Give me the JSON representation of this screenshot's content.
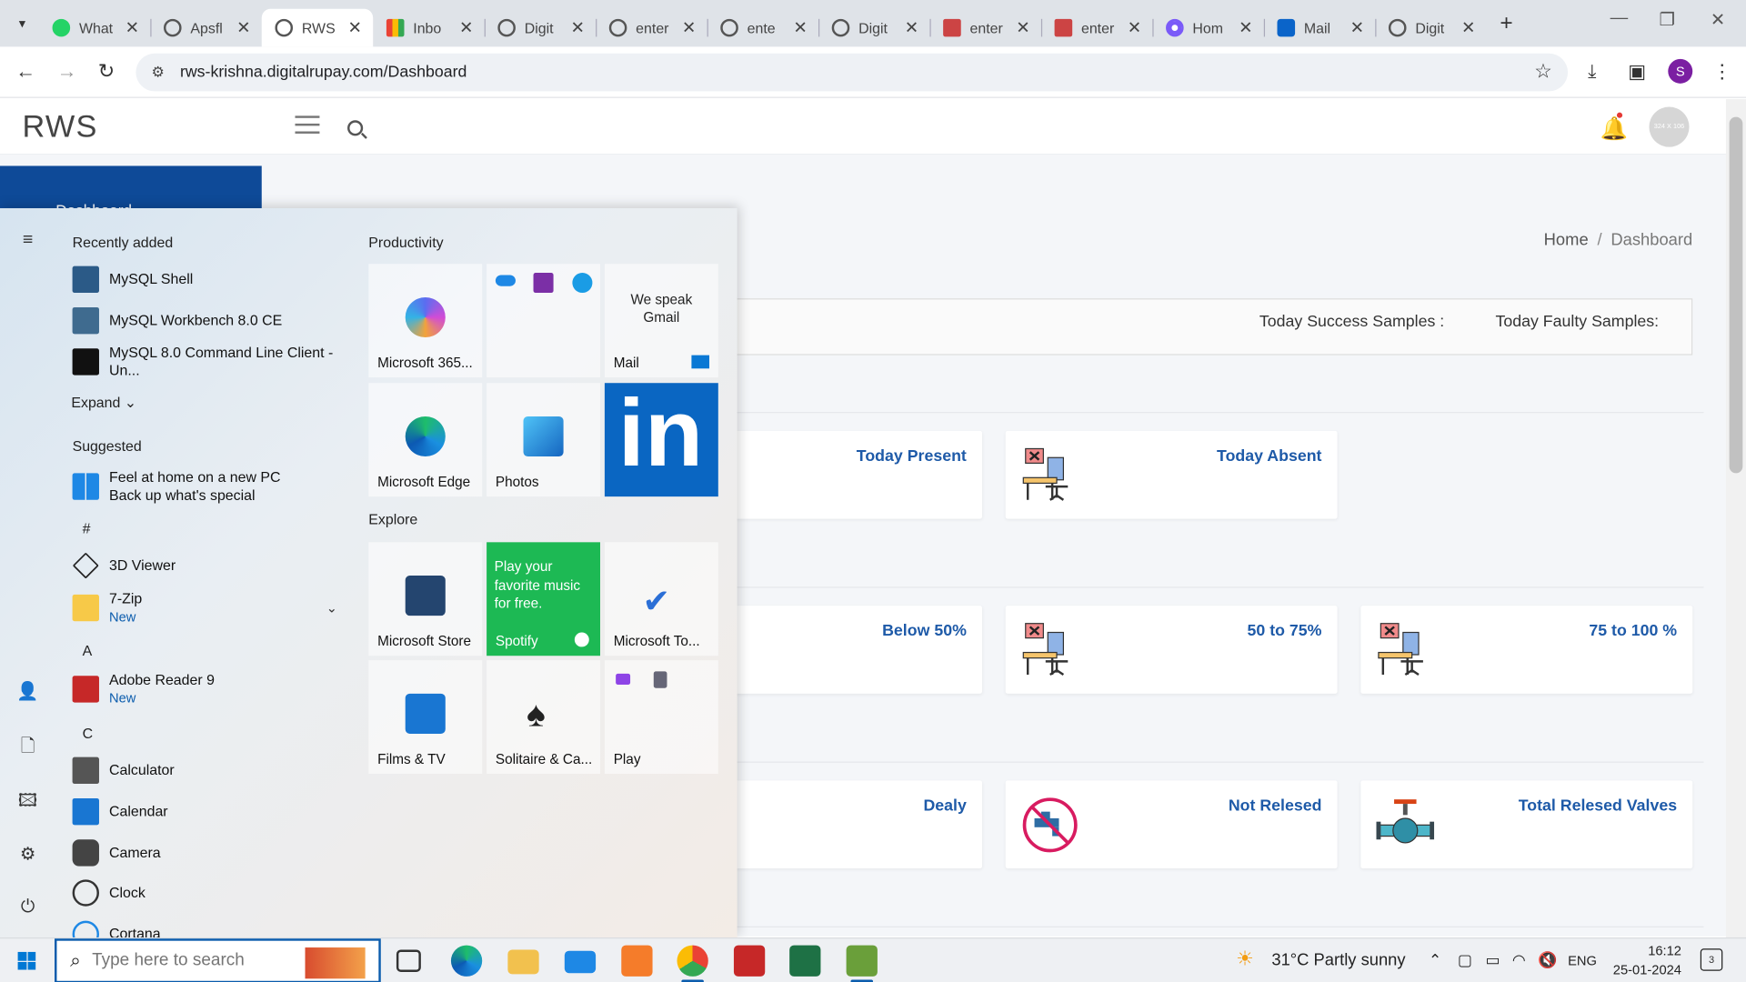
{
  "browser": {
    "tabs": [
      {
        "title": "What",
        "icon": "whatsapp-icon",
        "active": false
      },
      {
        "title": "Apsfl",
        "icon": "globe-icon",
        "active": false
      },
      {
        "title": "RWS",
        "icon": "globe-icon",
        "active": true
      },
      {
        "title": "Inbo",
        "icon": "gmail-icon",
        "active": false
      },
      {
        "title": "Digit",
        "icon": "globe-icon",
        "active": false
      },
      {
        "title": "enter",
        "icon": "globe-icon",
        "active": false
      },
      {
        "title": "ente",
        "icon": "globe-icon",
        "active": false
      },
      {
        "title": "Digit",
        "icon": "globe-icon",
        "active": false
      },
      {
        "title": "enter",
        "icon": "printer-logo-icon",
        "active": false
      },
      {
        "title": "enter",
        "icon": "printer-logo-icon",
        "active": false
      },
      {
        "title": "Hom",
        "icon": "copilot-icon",
        "active": false
      },
      {
        "title": "Mail",
        "icon": "outlook-icon",
        "active": false
      },
      {
        "title": "Digit",
        "icon": "globe-icon",
        "active": false
      }
    ],
    "url": "rws-krishna.digitalrupay.com/Dashboard",
    "profile_initial": "S"
  },
  "site": {
    "brand": "RWS",
    "sidebar_partial_label": "Dashboard",
    "avatar_text": "324 X 106",
    "breadcrumb": {
      "home": "Home",
      "separator": "/",
      "current": "Dashboard"
    },
    "samples": {
      "success": "Today Success Samples :",
      "faulty": "Today Faulty Samples:"
    },
    "cards": {
      "today_present": "Today Present",
      "today_absent": "Today Absent",
      "below_50": "Below 50%",
      "50_to_75": "50 to 75%",
      "75_to_100": "75 to 100 %",
      "dealy": "Dealy",
      "not_relesed": "Not Relesed",
      "total_relesed": "Total Relesed Valves"
    }
  },
  "start_menu": {
    "recently_added": "Recently added",
    "recent_apps": [
      "MySQL Shell",
      "MySQL Workbench 8.0 CE",
      "MySQL 8.0 Command Line Client - Un..."
    ],
    "expand": "Expand",
    "suggested": "Suggested",
    "suggested_item": {
      "line1": "Feel at home on a new PC",
      "line2": "Back up what's special"
    },
    "hash_header": "#",
    "viewer": "3D Viewer",
    "zip": {
      "name": "7-Zip",
      "badge": "New"
    },
    "a_header": "A",
    "adobe": {
      "name": "Adobe Reader 9",
      "badge": "New"
    },
    "c_header": "C",
    "c_apps": [
      "Calculator",
      "Calendar",
      "Camera",
      "Clock",
      "Cortana"
    ],
    "productivity": "Productivity",
    "explore": "Explore",
    "tiles": {
      "m365": "Microsoft 365...",
      "mail": "Mail",
      "mail_promo": "We speak Gmail",
      "edge": "Microsoft Edge",
      "photos": "Photos",
      "linkedin": "in",
      "store": "Microsoft Store",
      "spotify": "Spotify",
      "spotify_promo": "Play your favorite music for free.",
      "todo": "Microsoft To...",
      "films": "Films & TV",
      "solitaire": "Solitaire & Ca...",
      "play": "Play"
    }
  },
  "taskbar": {
    "search_placeholder": "Type here to search",
    "weather": "31°C  Partly sunny",
    "language": "ENG",
    "time": "16:12",
    "date": "25-01-2024",
    "notifications": "3"
  },
  "colors": {
    "accent": "#0b5cad",
    "sidebar": "#0e4a98",
    "card_label": "#1e5aa8",
    "spotify": "#1db954",
    "linkedin": "#0a66c2"
  }
}
